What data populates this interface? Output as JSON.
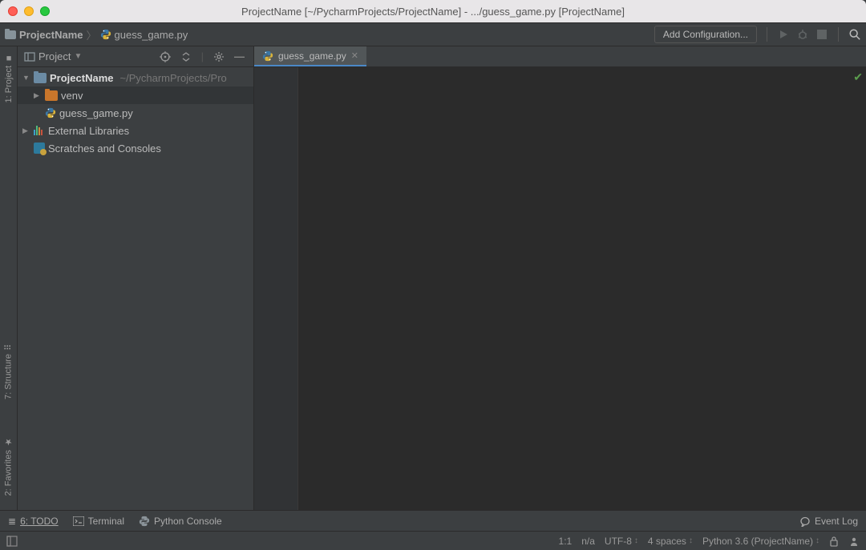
{
  "window": {
    "title": "ProjectName [~/PycharmProjects/ProjectName] - .../guess_game.py [ProjectName]"
  },
  "breadcrumb": {
    "project": "ProjectName",
    "file": "guess_game.py"
  },
  "navbar": {
    "add_config": "Add Configuration..."
  },
  "panel": {
    "title": "Project"
  },
  "tree": {
    "root": {
      "name": "ProjectName",
      "path": "~/PycharmProjects/Pro"
    },
    "venv": "venv",
    "file": "guess_game.py",
    "external": "External Libraries",
    "scratches": "Scratches and Consoles"
  },
  "rail": {
    "project": "1: Project",
    "structure": "7: Structure",
    "favorites": "2: Favorites"
  },
  "tab": {
    "name": "guess_game.py"
  },
  "bottom": {
    "todo": "6: TODO",
    "terminal": "Terminal",
    "console": "Python Console",
    "eventlog": "Event Log"
  },
  "status": {
    "pos": "1:1",
    "na": "n/a",
    "encoding": "UTF-8",
    "indent": "4 spaces",
    "interpreter": "Python 3.6 (ProjectName)"
  }
}
